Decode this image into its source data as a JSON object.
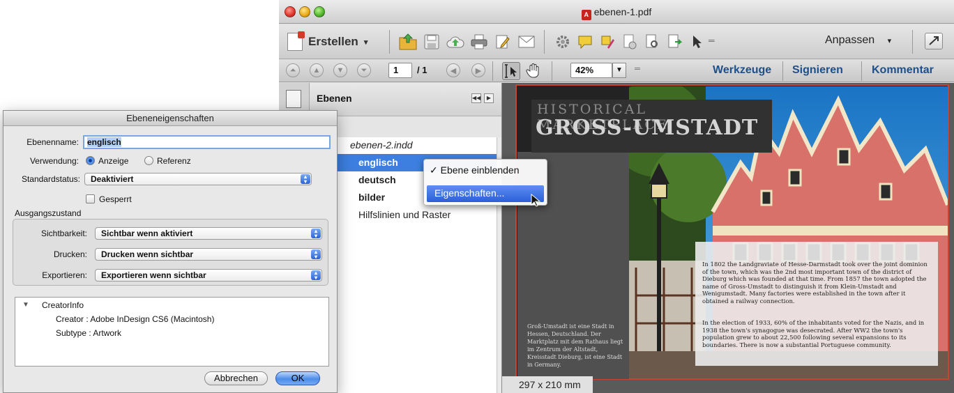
{
  "window": {
    "title": "ebenen-1.pdf"
  },
  "toolbar": {
    "create_label": "Erstellen",
    "customize_label": "Anpassen"
  },
  "nav": {
    "page": "1",
    "page_total": "/ 1",
    "zoom": "42%",
    "tools_label": "Werkzeuge",
    "sign_label": "Signieren",
    "comment_label": "Kommentar"
  },
  "layers_panel": {
    "title": "Ebenen",
    "document": "ebenen-2.indd",
    "items": [
      {
        "label": "englisch"
      },
      {
        "label": "deutsch"
      },
      {
        "label": "bilder"
      },
      {
        "label": "Hilfslinien und Raster"
      }
    ]
  },
  "context_menu": {
    "show_layer": "✓ Ebene einblenden",
    "properties": "Eigenschaften..."
  },
  "document": {
    "title_top": "HISTORICAL MARKETPLACE",
    "title_main": "GROSS-UMSTADT",
    "side_text": "Groß-Umstadt ist eine Stadt in Hessen, Deutschland. Der Marktplatz mit dem Rathaus liegt im Zentrum der Altstadt, Kreisstadt Dieburg, ist eine Stadt in Germany.",
    "para1": "In 1802 the Landgraviate of Hesse-Darmstadt took over the joint dominion of the town, which was the 2nd most important town of the district of Dieburg which was founded at that time. From 1857 the town adopted the name of Gross-Umstadt to distinguish it from Klein-Umstadt and Wenigumstadt. Many factories were established in the town after it obtained a railway connection.",
    "para2": "In the election of 1933, 60% of the inhabitants voted for the Nazis, and in 1938 the town's synagogue was desecrated. After WW2 the town's population grew to about 22,500 following several expansions to its boundaries. There is now a substantial Portuguese community.",
    "size": "297 x 210 mm"
  },
  "dialog": {
    "title": "Ebeneneigenschaften",
    "name_label": "Ebenenname:",
    "name_value": "englisch",
    "usage_label": "Verwendung:",
    "usage_option1": "Anzeige",
    "usage_option2": "Referenz",
    "default_state_label": "Standardstatus:",
    "default_state_value": "Deaktiviert",
    "locked_label": "Gesperrt",
    "output_state_label": "Ausgangszustand",
    "visibility_label": "Sichtbarkeit:",
    "visibility_value": "Sichtbar wenn aktiviert",
    "print_label": "Drucken:",
    "print_value": "Drucken wenn sichtbar",
    "export_label": "Exportieren:",
    "export_value": "Exportieren wenn sichtbar",
    "info_root": "CreatorInfo",
    "info_creator": "Creator : Adobe InDesign CS6 (Macintosh)",
    "info_subtype": "Subtype : Artwork",
    "cancel_label": "Abbrechen",
    "ok_label": "OK"
  },
  "colors": {
    "selection": "#3d7fe0",
    "link": "#1d4f8a",
    "page_border": "#c84432"
  }
}
